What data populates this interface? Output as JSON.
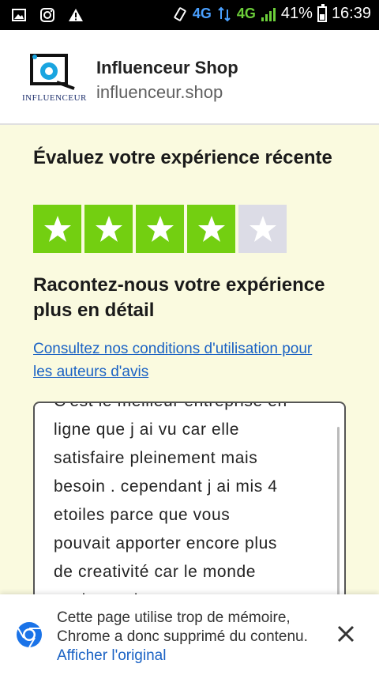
{
  "status_bar": {
    "network_1": "4G",
    "network_2": "4G",
    "battery": "41%",
    "time": "16:39"
  },
  "header": {
    "logo_text": "INFLUENCEUR",
    "shop_name": "Influenceur Shop",
    "shop_url": "influenceur.shop"
  },
  "review": {
    "rate_heading": "Évaluez votre expérience récente",
    "rating": 4,
    "rating_max": 5,
    "detail_heading": "Racontez-nous votre expérience plus en détail",
    "guidelines_link": "Consultez nos conditions d'utilisation pour les auteurs d'avis",
    "text": "C'est le meilleur entreprise en\nligne que j ai vu car elle\nsatisfaire pleinement mais\nbesoin . cependant j ai mis 4\netoiles parce que vous\npouvait apporter encore plus\nde creativité car le monde\nevolue a chaque moment"
  },
  "snackbar": {
    "message": "Cette page utilise trop de mémoire, Chrome a donc supprimé du contenu.",
    "action": "Afficher l'original"
  },
  "colors": {
    "star_on": "#73cf11",
    "star_off": "#dcdce6",
    "link": "#1a62c4",
    "page_bg": "#fafadf"
  }
}
